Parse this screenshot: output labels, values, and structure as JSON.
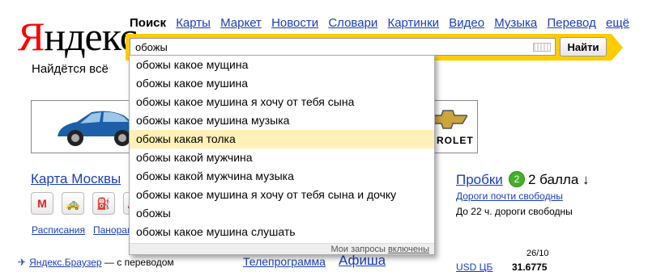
{
  "logo": {
    "first_letter": "Я",
    "rest": "ндекс"
  },
  "slogan": "Найдётся всё",
  "tabs": [
    {
      "label": "Поиск",
      "active": true
    },
    {
      "label": "Карты",
      "active": false
    },
    {
      "label": "Маркет",
      "active": false
    },
    {
      "label": "Новости",
      "active": false
    },
    {
      "label": "Словари",
      "active": false
    },
    {
      "label": "Картинки",
      "active": false
    },
    {
      "label": "Видео",
      "active": false
    },
    {
      "label": "Музыка",
      "active": false
    },
    {
      "label": "Перевод",
      "active": false
    },
    {
      "label": "ещё",
      "active": false
    }
  ],
  "search": {
    "value": "обожы",
    "button_label": "Найти"
  },
  "suggestions": {
    "items": [
      "обожы какое мущина",
      "обожы какое мушина",
      "обожы какое мушина я хочу от тебя сына",
      "обожы какое мушина музыка",
      "обожы какая толка",
      "обожы какой мужчина",
      "обожы какой мужчина музыка",
      "обожы какое мушина я хочу от тебя сына и дочку",
      "обожы",
      "обожы какое мушина слушать"
    ],
    "selected_index": 4,
    "footer_text": "Мои запросы",
    "footer_link": "включены"
  },
  "banner": {
    "brand_text": "ROLET"
  },
  "left": {
    "map_link": "Карта Москвы",
    "map_icons": [
      "М",
      "🚕",
      "⛽",
      "🚗",
      "🛒"
    ],
    "schedule_link": "Расписания",
    "panorama_link": "Панорам"
  },
  "browser": {
    "link": "Яндекс.Браузер",
    "tail": "— с переводом"
  },
  "tv_link": "Телепрограмма",
  "afisha_link": "Афиша",
  "traffic": {
    "link": "Пробки",
    "score_badge": "2",
    "score_text": "2 балла ↓",
    "sub1": "Дороги почти свободны",
    "sub2": "До 22 ч. дороги свободны"
  },
  "rates": {
    "date": "26/10",
    "label": "USD ЦБ",
    "value": "31.6775"
  },
  "colors": {
    "accent_yellow": "#ffcc00",
    "link_blue": "#1a3dc1",
    "logo_red": "#ff0000",
    "suggest_highlight": "#fff1b8"
  }
}
